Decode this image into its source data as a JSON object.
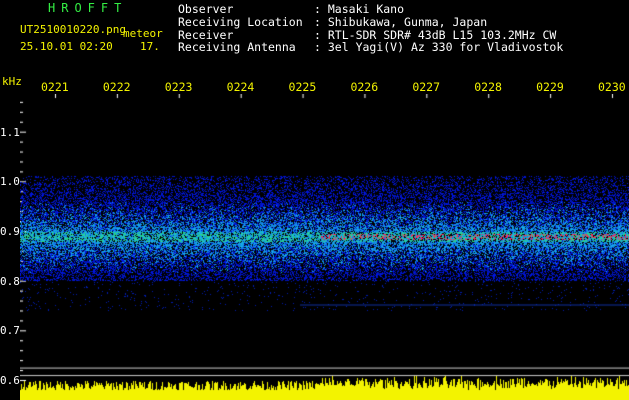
{
  "header": {
    "brand": "HROFFT",
    "filename": "UT2510010220.png",
    "meteor_label": "meteor",
    "datetime": "25.10.01 02:20",
    "count": "17.",
    "info": [
      {
        "label": "Observer",
        "sep": ":",
        "value": "Masaki Kano"
      },
      {
        "label": "Receiving Location",
        "sep": ":",
        "value": "Shibukawa, Gunma, Japan"
      },
      {
        "label": "Receiver",
        "sep": ":",
        "value": "RTL-SDR SDR# 43dB L15 103.2MHz CW"
      },
      {
        "label": "Receiving Antenna",
        "sep": ":",
        "value": "3el Yagi(V) Az 330 for Vladivostok"
      }
    ]
  },
  "chart_data": {
    "type": "heatmap",
    "yunit": "kHz",
    "ylim": [
      0.6,
      1.2
    ],
    "yticks": [
      "1.1",
      "1.0",
      "0.9",
      "0.8",
      "0.7",
      "0.6"
    ],
    "xticks": [
      "0221",
      "0222",
      "0223",
      "0224",
      "0225",
      "0226",
      "0227",
      "0228",
      "0229",
      "0230"
    ],
    "signal_center_khz": 0.888,
    "noise_band_khz": [
      0.8,
      1.01
    ],
    "colors": {
      "noise": "#0a30d0",
      "signal": "#30e060",
      "peak": "#ff2060",
      "meter": "#f3f300",
      "axis": "#ffffff"
    }
  }
}
